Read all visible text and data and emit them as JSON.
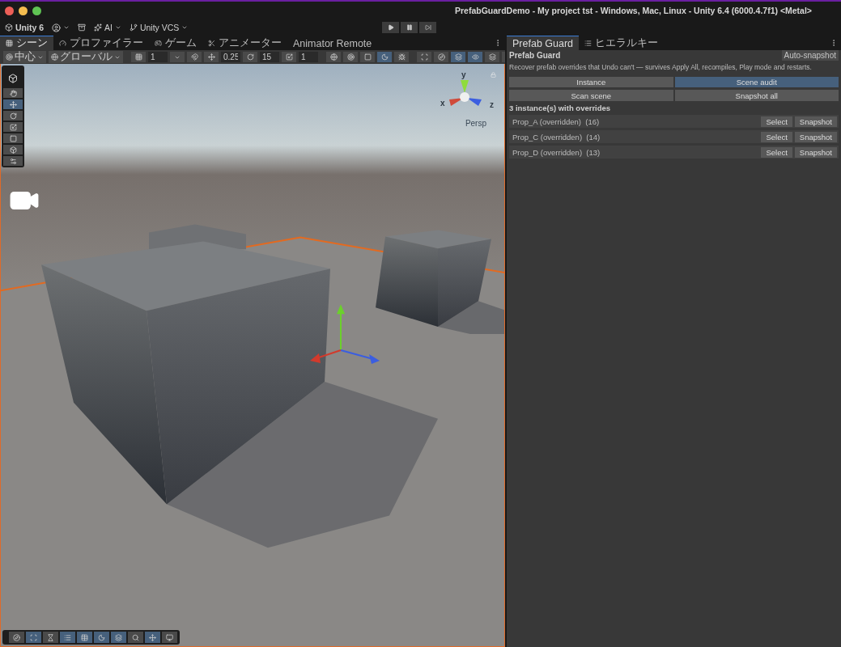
{
  "window": {
    "title": "PrefabGuardDemo - My project tst - Windows, Mac, Linux - Unity 6.4 (6000.4.7f1) <Metal>"
  },
  "main_toolbar": {
    "product": "Unity 6",
    "ai": "AI",
    "vcs": "Unity VCS"
  },
  "scene_tabs": [
    {
      "label": "シーン",
      "kind": "grid",
      "selected": true
    },
    {
      "label": "プロファイラー",
      "kind": "profiler",
      "selected": false
    },
    {
      "label": "ゲーム",
      "kind": "game",
      "selected": false
    },
    {
      "label": "アニメーター",
      "kind": "animator",
      "selected": false
    },
    {
      "label": "Animator Remote",
      "kind": "none",
      "selected": false
    }
  ],
  "scene_toolbar": {
    "pivot": "中心",
    "space": "グローバル",
    "grid_size": "1",
    "snap_move": "0.25",
    "snap_rotate": "15",
    "snap_scale": "1",
    "shading_modes": [
      {
        "kind": "wire",
        "selected": false
      },
      {
        "kind": "shaded-wire",
        "selected": false
      },
      {
        "kind": "shaded",
        "selected": false
      },
      {
        "kind": "lit",
        "selected": true
      }
    ]
  },
  "tools": [
    {
      "kind": "hand",
      "selected": false
    },
    {
      "kind": "move",
      "selected": true
    },
    {
      "kind": "rotate",
      "selected": false
    },
    {
      "kind": "scale",
      "selected": false
    },
    {
      "kind": "rect",
      "selected": false
    },
    {
      "kind": "transform",
      "selected": false
    },
    {
      "kind": "custom",
      "selected": false
    }
  ],
  "gizmo": {
    "y": "y",
    "x": "x",
    "z": "z",
    "projection": "Persp"
  },
  "overlay_toolbar": [
    {
      "kind": "compass",
      "selected": false
    },
    {
      "kind": "scan",
      "selected": true
    },
    {
      "kind": "hourglass",
      "selected": false
    },
    {
      "kind": "list",
      "selected": true
    },
    {
      "kind": "table",
      "selected": true
    },
    {
      "kind": "moon",
      "selected": true
    },
    {
      "kind": "layers",
      "selected": true
    },
    {
      "kind": "search",
      "selected": false
    },
    {
      "kind": "move",
      "selected": true
    },
    {
      "kind": "screen",
      "selected": false
    }
  ],
  "panel": {
    "tabs": [
      {
        "label": "Prefab Guard",
        "kind": "none",
        "selected": true
      },
      {
        "label": "ヒエラルキー",
        "kind": "list",
        "selected": false
      }
    ],
    "title": "Prefab Guard",
    "auto_snapshot": "Auto-snapshot",
    "description": "Recover prefab overrides that Undo can't — survives Apply All, recompiles, Play mode and restarts.",
    "modes": [
      {
        "label": "Instance",
        "selected": false
      },
      {
        "label": "Scene audit",
        "selected": true
      }
    ],
    "actions": [
      "Scan scene",
      "Snapshot all"
    ],
    "summary": "3 instance(s) with overrides",
    "rows": [
      {
        "name": "Prop_A (overridden)",
        "count": "(16)",
        "buttons": [
          "Select",
          "Snapshot"
        ]
      },
      {
        "name": "Prop_C (overridden)",
        "count": "(14)",
        "buttons": [
          "Select",
          "Snapshot"
        ]
      },
      {
        "name": "Prop_D (overridden)",
        "count": "(13)",
        "buttons": [
          "Select",
          "Snapshot"
        ]
      }
    ]
  }
}
